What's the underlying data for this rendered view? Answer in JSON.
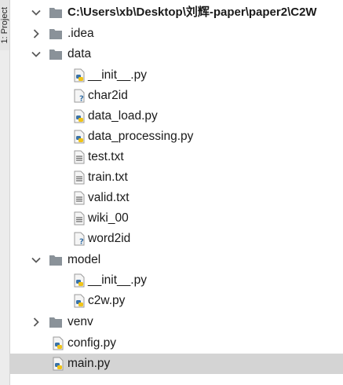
{
  "side_panel": {
    "tab_label": "1: Project"
  },
  "tree": {
    "root": {
      "label": "C:\\Users\\xb\\Desktop\\刘辉-paper\\paper2\\C2W",
      "icon": "folder-icon",
      "expanded": true
    },
    "items": [
      {
        "label": ".idea",
        "icon": "folder-icon",
        "expanded": false
      },
      {
        "label": "data",
        "icon": "folder-icon",
        "expanded": true
      },
      {
        "label": "__init__.py",
        "icon": "python-file-icon"
      },
      {
        "label": "char2id",
        "icon": "unknown-file-icon"
      },
      {
        "label": "data_load.py",
        "icon": "python-file-icon"
      },
      {
        "label": "data_processing.py",
        "icon": "python-file-icon"
      },
      {
        "label": "test.txt",
        "icon": "text-file-icon"
      },
      {
        "label": "train.txt",
        "icon": "text-file-icon"
      },
      {
        "label": "valid.txt",
        "icon": "text-file-icon"
      },
      {
        "label": "wiki_00",
        "icon": "text-file-icon"
      },
      {
        "label": "word2id",
        "icon": "unknown-file-icon"
      },
      {
        "label": "model",
        "icon": "folder-icon",
        "expanded": true
      },
      {
        "label": "__init__.py",
        "icon": "python-file-icon"
      },
      {
        "label": "c2w.py",
        "icon": "python-file-icon"
      },
      {
        "label": "venv",
        "icon": "folder-icon",
        "expanded": false
      },
      {
        "label": "config.py",
        "icon": "python-file-icon"
      },
      {
        "label": "main.py",
        "icon": "python-file-icon",
        "selected": true
      }
    ]
  },
  "colors": {
    "folder": "#8a9299",
    "selection": "#d4d4d4",
    "python_blue": "#3a73a8",
    "python_yellow": "#f0c419"
  }
}
